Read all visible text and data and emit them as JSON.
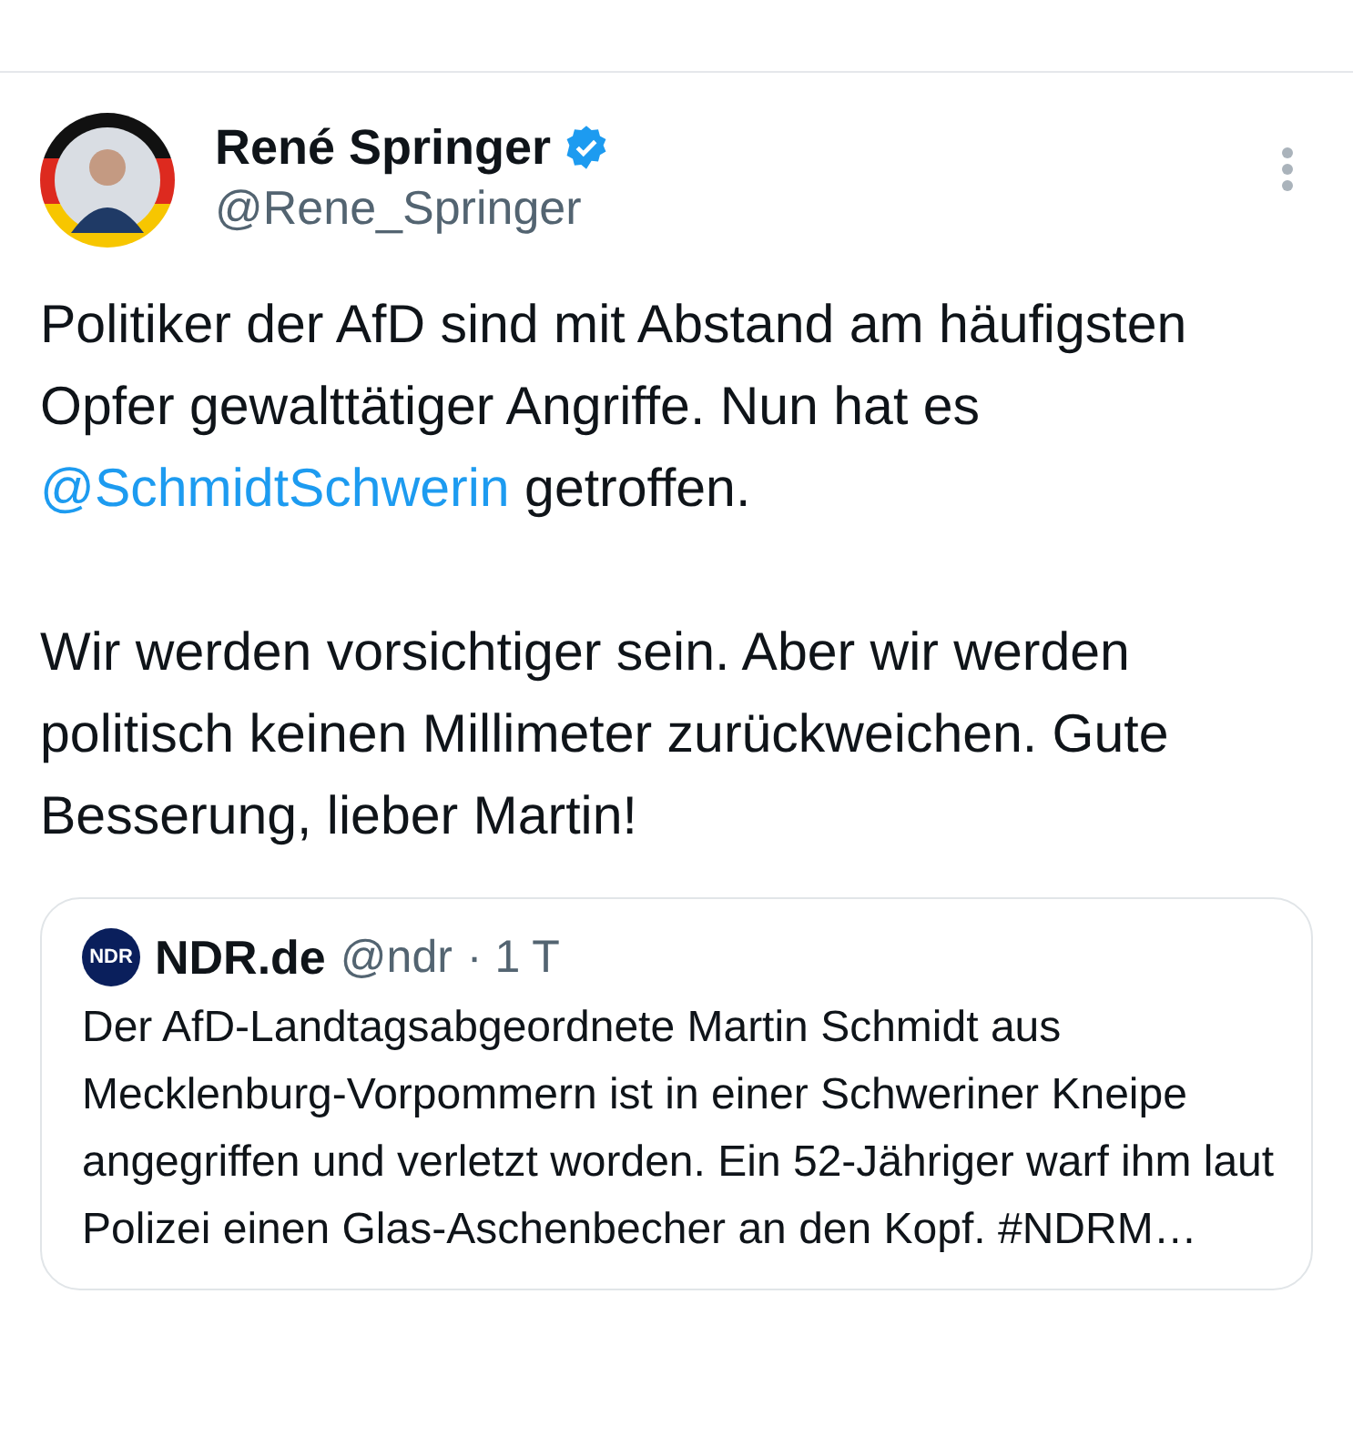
{
  "author": {
    "name": "René Springer",
    "verified": true,
    "handle": "@Rene_Springer"
  },
  "post": {
    "paragraphs": [
      [
        {
          "kind": "text",
          "text": "Politiker der AfD sind mit Abstand am häufigsten Opfer gewalttätiger Angriffe. Nun hat es "
        },
        {
          "kind": "mention",
          "text": "@SchmidtSchwerin"
        },
        {
          "kind": "text",
          "text": " getroffen."
        }
      ],
      [
        {
          "kind": "text",
          "text": "Wir werden vorsichtiger sein. Aber wir werden politisch keinen Millimeter zurückweichen. Gute Besserung, lieber Martin!"
        }
      ]
    ]
  },
  "quote": {
    "logo_text": "NDR",
    "name": "NDR.de",
    "handle": "@ndr",
    "time": "· 1 T",
    "text": "Der AfD-Landtagsabgeordnete Martin Schmidt aus Mecklenburg-Vorpommern ist in einer Schweriner Kneipe angegriffen und verletzt worden. Ein 52-Jähriger warf ihm laut Polizei einen Glas-Aschenbecher an den Kopf. #NDRM…"
  }
}
